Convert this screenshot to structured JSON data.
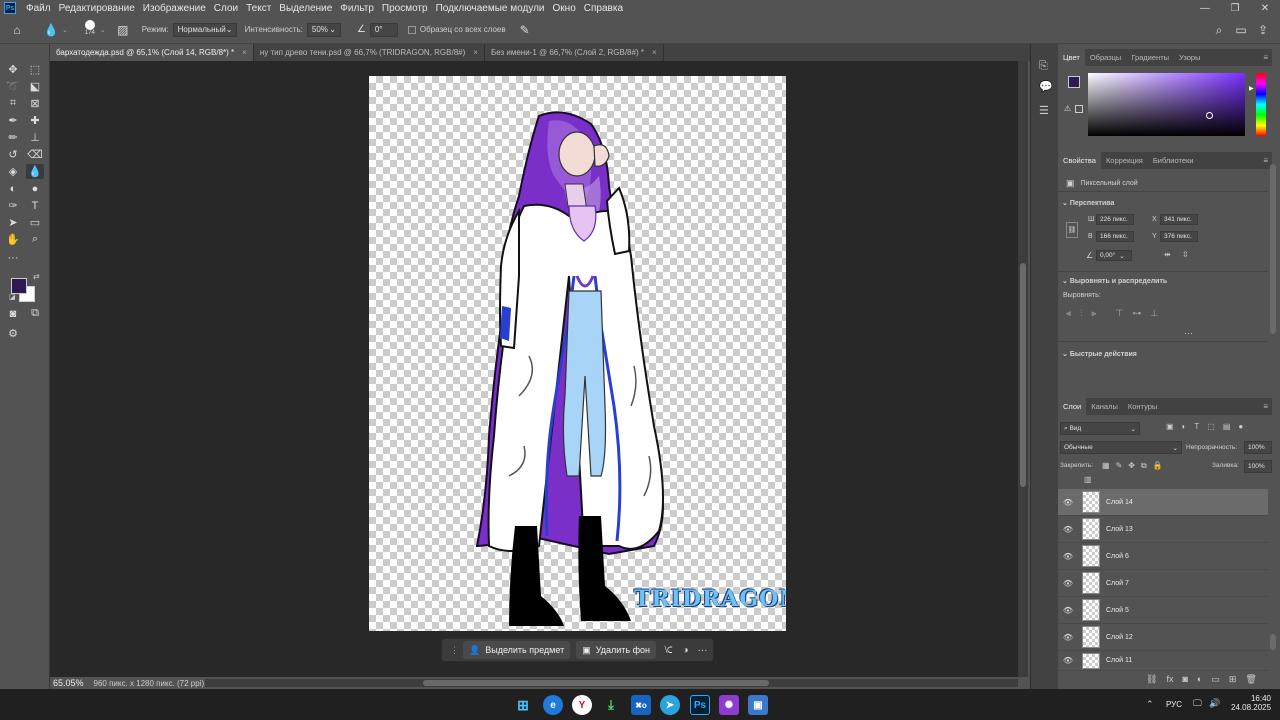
{
  "app": {
    "logo_text": "Ps",
    "menu": [
      "Файл",
      "Редактирование",
      "Изображение",
      "Слои",
      "Текст",
      "Выделение",
      "Фильтр",
      "Просмотр",
      "Подключаемые модули",
      "Окно",
      "Справка"
    ],
    "window_controls": [
      "—",
      "❐",
      "✕"
    ]
  },
  "options_bar": {
    "brush_size": "174",
    "mode_label": "Режим:",
    "mode_value": "Нормальный",
    "intensity_label": "Интенсивность:",
    "intensity_value": "50%",
    "angle_value": "0°",
    "sample_all_label": "Образец со всех слоев"
  },
  "tabs": [
    {
      "label": "бархатодежда.psd @ 65,1% (Слой 14, RGB/8*) *",
      "close": "×"
    },
    {
      "label": "ну тип древо тени.psd @ 66,7% (TRIDRAGON, RGB/8#)",
      "close": "×"
    },
    {
      "label": "Без имени-1 @ 66,7% (Слой 2, RGB/8#) *",
      "close": "×"
    }
  ],
  "canvas": {
    "watermark": "TRIDRAGON"
  },
  "context_bar": {
    "select_subject": "Выделить предмет",
    "remove_bg": "Удалить фон"
  },
  "status": {
    "zoom": "65.05%",
    "doc_info": "960 пикс. x 1280 пикс. (72 ppi)"
  },
  "colors": {
    "foreground": "#2d1a55",
    "background": "#ffffff"
  },
  "color_panel": {
    "tabs": [
      "Цвет",
      "Образцы",
      "Градиенты",
      "Узоры"
    ]
  },
  "properties_panel": {
    "tabs": [
      "Свойства",
      "Коррекция",
      "Библиотеки"
    ],
    "layer_type": "Пиксельный слой",
    "section_transform": "Перспектива",
    "w_label": "Ш",
    "w_value": "226 пикс.",
    "x_label": "X",
    "x_value": "341 пикс.",
    "h_label": "В",
    "h_value": "166 пикс.",
    "y_label": "Y",
    "y_value": "376 пикс.",
    "angle_value": "0,00°",
    "section_align": "Выровнять и распределить",
    "align_label": "Выровнять:",
    "section_quick": "Быстрые действия"
  },
  "layers_panel": {
    "tabs": [
      "Слои",
      "Каналы",
      "Контуры"
    ],
    "filter_value": "Вид",
    "blend_mode": "Обычные",
    "opacity_label": "Непрозрачность:",
    "opacity_value": "100%",
    "lock_label": "Закрепить:",
    "fill_label": "Заливка:",
    "fill_value": "100%",
    "layers": [
      "Слой 14",
      "Слой 13",
      "Слой 6",
      "Слой 7",
      "Слой 5",
      "Слой 12",
      "Слой 11"
    ]
  },
  "taskbar": {
    "lang": "РУС",
    "time": "16:40",
    "date": "24.08.2025"
  }
}
